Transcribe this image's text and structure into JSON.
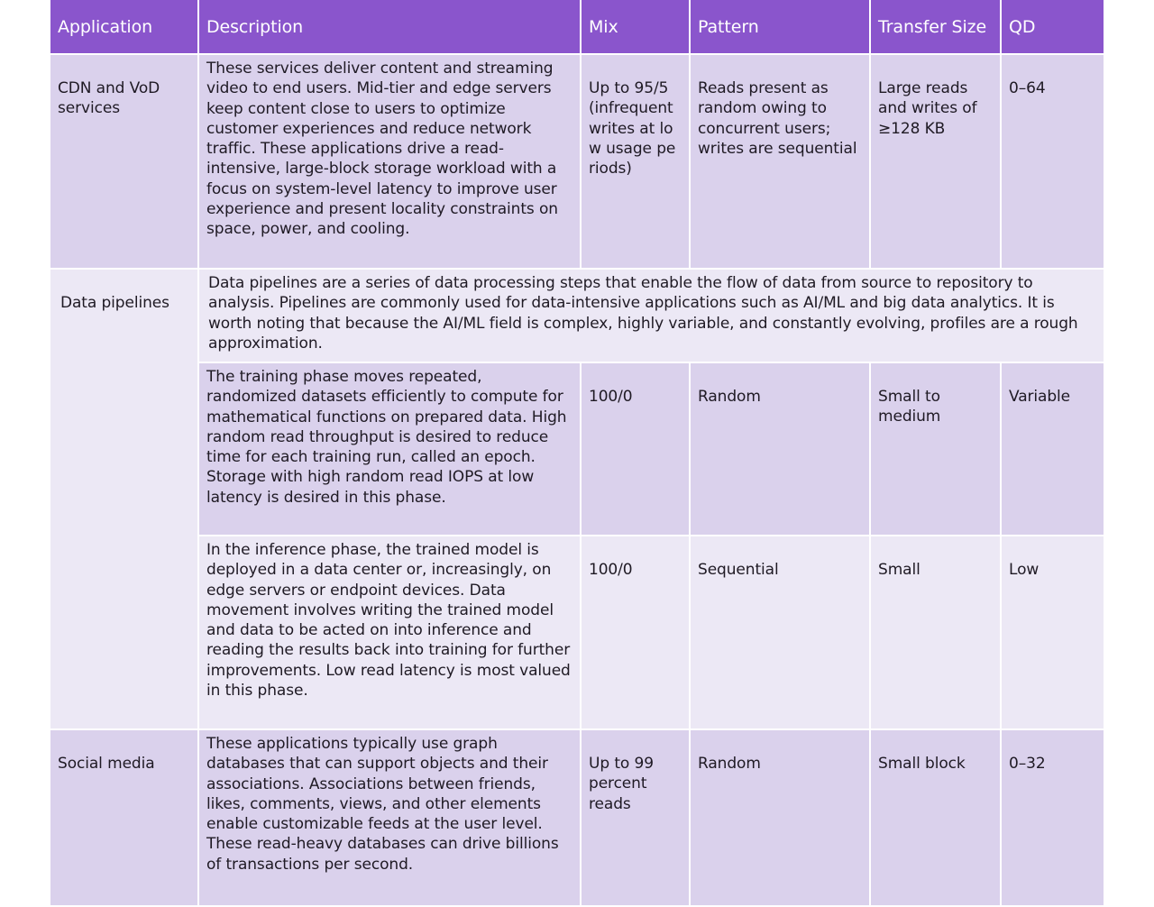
{
  "table": {
    "headers": [
      "Application",
      "Description",
      "Mix",
      "Pattern",
      "Transfer Size",
      "QD"
    ],
    "rows": {
      "cdn": {
        "application": "CDN and VoD services",
        "description": "These services deliver content and streaming video to end users. Mid-tier and edge servers keep content close to users to optimize customer experiences and reduce network traffic. These applications drive a read-intensive, large-block storage workload with a focus on system-level latency to improve user experience and present locality constraints on space, power, and cooling.",
        "mix": "Up to 95/5 (infrequent writes at low usage periods)",
        "pattern": "Reads present as random owing to concurrent users; writes are sequential",
        "transfer_size": "Large reads and writes of ≥128 KB",
        "qd": "0–64"
      },
      "data_pipelines": {
        "application": "Data pipelines",
        "intro": "Data pipelines are a series of data processing steps that enable the flow of data from source to repository to analysis. Pipelines are commonly used for data-intensive applications such as AI/ML and big data analytics. It is worth noting that because the AI/ML field is complex, highly variable, and constantly evolving, profiles are a rough approximation.",
        "training": {
          "description": "The training phase moves repeated, randomized datasets efficiently to compute for mathematical functions on prepared data. High random read throughput is desired to reduce time for each training run, called an epoch. Storage with high random read IOPS at low latency is desired in this phase.",
          "mix": "100/0",
          "pattern": "Random",
          "transfer_size": "Small to medium",
          "qd": "Variable"
        },
        "inference": {
          "description": "In the inference phase, the trained model is deployed in a data center or, increasingly, on edge servers or endpoint devices. Data movement involves writing the trained model and data to be acted on into inference and reading the results back into training for further improvements. Low read latency is most valued in this phase.",
          "mix": "100/0",
          "pattern": "Sequential",
          "transfer_size": "Small",
          "qd": "Low"
        }
      },
      "social": {
        "application": "Social media",
        "description": "These applications typically use graph databases that can support objects and their associations. Associations between friends, likes, comments, views, and other elements enable customizable feeds at the user level. These read-heavy databases can drive billions of transactions per second.",
        "mix": "Up to 99 percent reads",
        "pattern": "Random",
        "transfer_size": "Small block",
        "qd": "0–32"
      }
    }
  },
  "colors": {
    "header_bg": "#8a55cc",
    "row_dark": "#dad1ec",
    "row_light": "#ece8f5"
  }
}
